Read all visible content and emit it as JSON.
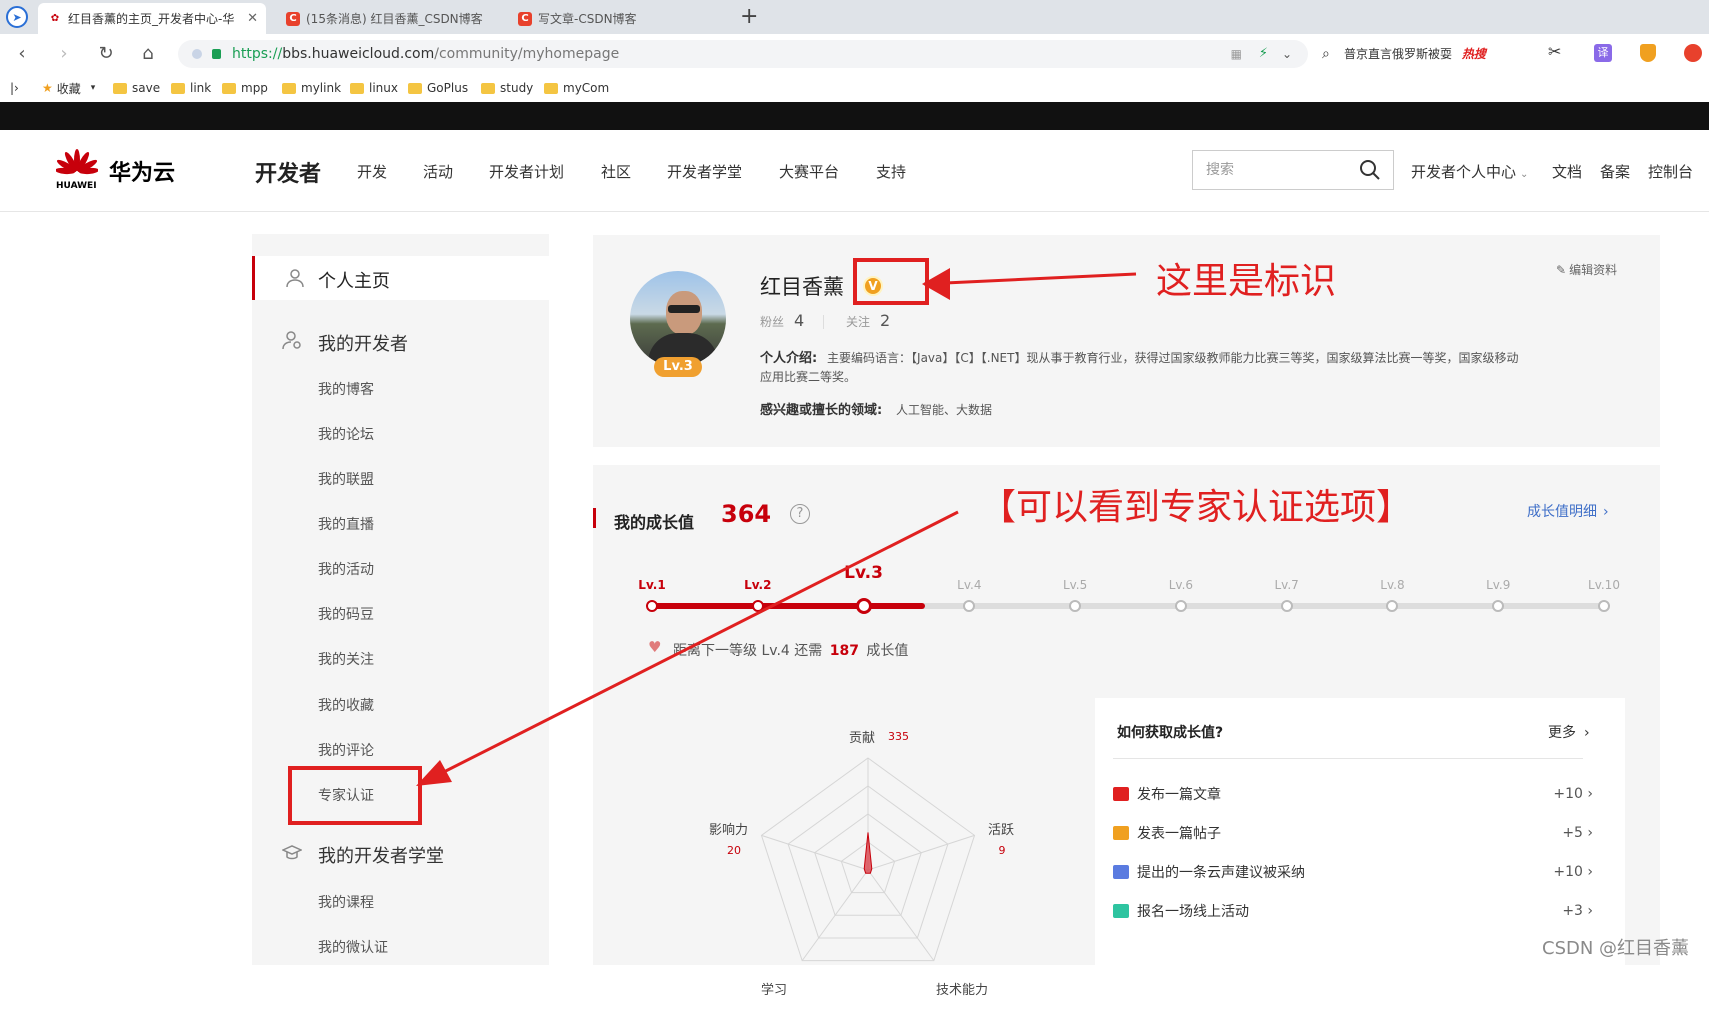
{
  "browser": {
    "tabs": [
      {
        "title": "红目香薰的主页_开发者中心-华",
        "active": true
      },
      {
        "title": "(15条消息) 红目香薰_CSDN博客",
        "active": false
      },
      {
        "title": "写文章-CSDN博客",
        "active": false
      }
    ],
    "url_scheme": "https://",
    "url_host": "bbs.huaweicloud.com",
    "url_path": "/community/myhomepage",
    "hot_search": "普京直言俄罗斯被耍",
    "hot_badge": "热搜",
    "bookmarks": [
      "收藏",
      "save",
      "link",
      "mpp",
      "mylink",
      "linux",
      "GoPlus",
      "study",
      "myCom"
    ]
  },
  "header": {
    "brand_cn": "华为云",
    "brand_en": "HUAWEI",
    "section": "开发者",
    "nav": [
      "开发",
      "活动",
      "开发者计划",
      "社区",
      "开发者学堂",
      "大赛平台",
      "支持"
    ],
    "search_placeholder": "搜索",
    "right_links": [
      "开发者个人中心",
      "文档",
      "备案",
      "控制台"
    ]
  },
  "sidebar": {
    "home": "个人主页",
    "dev_group": "我的开发者",
    "dev_items": [
      "我的博客",
      "我的论坛",
      "我的联盟",
      "我的直播",
      "我的活动",
      "我的码豆",
      "我的关注",
      "我的收藏",
      "我的评论",
      "专家认证"
    ],
    "school_group": "我的开发者学堂",
    "school_items": [
      "我的课程",
      "我的微认证"
    ]
  },
  "profile": {
    "name": "红目香薰",
    "badge_letter": "V",
    "level_badge": "Lv.3",
    "fans_label": "粉丝",
    "fans": "4",
    "follow_label": "关注",
    "follow": "2",
    "edit": "编辑资料",
    "intro_label": "个人介绍:",
    "intro_line1": "主要编码语言：【Java】【C】【.NET】现从事于教育行业，获得过国家级教师能力比赛三等奖，国家级算法比赛一等奖，国家级移动",
    "intro_line2": "应用比赛二等奖。",
    "interest_label": "感兴趣或擅长的领域:",
    "interest": "人工智能、大数据"
  },
  "growth": {
    "title": "我的成长值",
    "value": "364",
    "detail_link": "成长值明细",
    "levels": [
      "Lv.1",
      "Lv.2",
      "Lv.3",
      "Lv.4",
      "Lv.5",
      "Lv.6",
      "Lv.7",
      "Lv.8",
      "Lv.9",
      "Lv.10"
    ],
    "current_level_index": 2,
    "progress_fraction": 0.287,
    "next_text_a": "距离下一等级 Lv.4 还需",
    "next_points": "187",
    "next_text_b": "成长值",
    "radar": {
      "labels": [
        "贡献",
        "活跃",
        "技术能力",
        "学习",
        "影响力"
      ],
      "values": [
        "335",
        "9",
        "",
        "",
        "20"
      ],
      "max": 1000
    }
  },
  "how": {
    "title": "如何获取成长值?",
    "more": "更多",
    "tasks": [
      {
        "label": "发布一篇文章",
        "points": "+10",
        "icon": "article-icon",
        "color": "#e02020"
      },
      {
        "label": "发表一篇帖子",
        "points": "+5",
        "icon": "post-icon",
        "color": "#f0a020"
      },
      {
        "label": "提出的一条云声建议被采纳",
        "points": "+10",
        "icon": "suggestion-icon",
        "color": "#5a7be0"
      },
      {
        "label": "报名一场线上活动",
        "points": "+3",
        "icon": "activity-icon",
        "color": "#2ec4a0"
      }
    ]
  },
  "annotations": {
    "badge_note": "这里是标识",
    "expert_note": "【可以看到专家认证选项】"
  },
  "watermark": "CSDN @红目香薰"
}
